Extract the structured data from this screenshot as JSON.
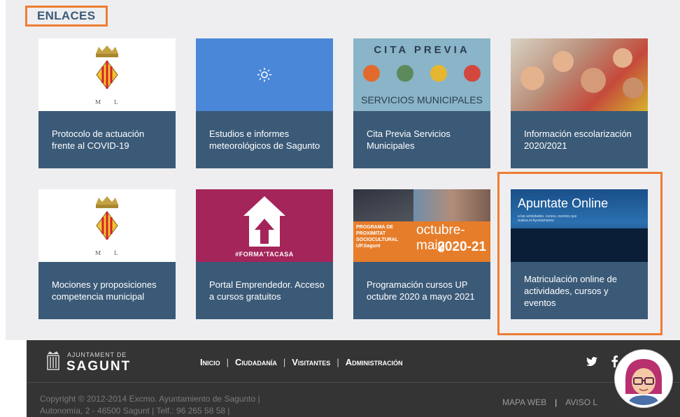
{
  "section_title": "ENLACES",
  "cards": [
    {
      "label": "Protocolo de actuación frente al COVID-19"
    },
    {
      "label": "Estudios e informes meteorológicos de Sagunto"
    },
    {
      "label": "Cita Previa Servicios Municipales",
      "thumb_top": "CITA PREVIA",
      "thumb_bottom": "SERVICIOS MUNICIPALES"
    },
    {
      "label": "Información escolarización 2020/2021"
    },
    {
      "label": "Mociones y proposiciones competencia municipal"
    },
    {
      "label": "Portal Emprendedor. Acceso a cursos gratuitos",
      "thumb_text": "#FORMA'TACASA"
    },
    {
      "label": "Programación cursos UP octubre 2020 a mayo 2021",
      "thumb_small": "PROGRAMA DE PROXIMITAT SOCIOCULTURAL UP.Sagunt",
      "thumb_main": "octubre-maig",
      "thumb_year": "2020-21"
    },
    {
      "label": "Matriculación online de actividades, cursos y eventos",
      "thumb_title": "Apuntate Online",
      "thumb_sub": "a las actividades, cursos, eventos que realiza el Ayuntamiento"
    }
  ],
  "footer": {
    "logo_small": "AJUNTAMENT DE",
    "logo_big": "SAGUNT",
    "nav": [
      "Inicio",
      "Ciudadanía",
      "Visitantes",
      "Administración"
    ],
    "copyright_line1": "Copyright © 2012-2014 Excmo. Ayuntamiento de Sagunto |",
    "copyright_line2": "Autonomía, 2 - 46500 Sagunt | Telf.: 96 265 58 58 |",
    "mapa": "MAPA WEB",
    "aviso": "AVISO L"
  },
  "crest_letters": [
    "M",
    "L"
  ],
  "icons": [
    "sun-icon",
    "house-arrow-icon",
    "twitter-icon",
    "facebook-icon",
    "crest-icon",
    "assistant-avatar-icon"
  ],
  "colors": {
    "card": "#3b5a78",
    "accent": "#ee7d32",
    "footer": "#343434",
    "background": "#eeeef0"
  }
}
